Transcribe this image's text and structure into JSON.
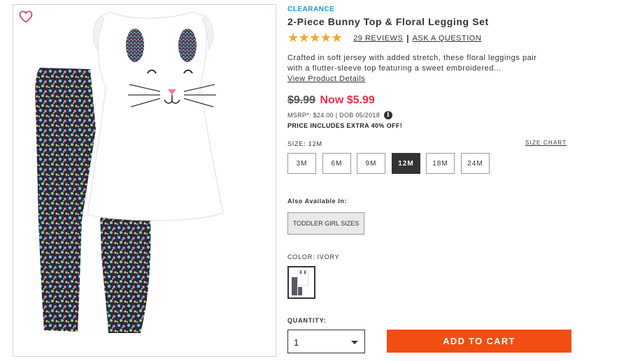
{
  "product": {
    "badge": "CLEARANCE",
    "title": "2-Piece Bunny Top & Floral Legging Set",
    "stars": "★★★★★",
    "rating": 5,
    "reviews_label": "29 REVIEWS",
    "separator": "|",
    "ask_question_label": "ASK A QUESTION",
    "description": "Crafted in soft jersey with added stretch, these floral leggings pair with a flutter-sleeve top featuring a sweet embroidered...",
    "view_details_label": "View Product Details"
  },
  "pricing": {
    "old_price": "$9.99",
    "now_price": "Now $5.99",
    "msrp_text": "MSRP*: $24.00 | DOB 05/2018",
    "info_icon_glyph": "i",
    "promo_text": "PRICE INCLUDES EXTRA 40% OFF!"
  },
  "size": {
    "label": "SIZE:",
    "selected": "12M",
    "chart_label": "SIZE CHART",
    "options": [
      "3M",
      "6M",
      "9M",
      "12M",
      "18M",
      "24M"
    ]
  },
  "also_available": {
    "label": "Also Available In:",
    "button_label": "TODDLER GIRL SIZES"
  },
  "color": {
    "label": "COLOR:",
    "selected": "IVORY"
  },
  "quantity": {
    "label": "QUANTITY:",
    "value": "1"
  },
  "cart": {
    "button_label": "ADD TO CART"
  },
  "icons": {
    "favorite": "heart-icon",
    "info": "info-icon",
    "dropdown": "chevron-down-icon"
  },
  "colors": {
    "accent_blue": "#1a9ad6",
    "sale_red": "#e8304a",
    "star_gold": "#f5a623",
    "cart_orange": "#f04e12",
    "selected_dark": "#333333"
  }
}
